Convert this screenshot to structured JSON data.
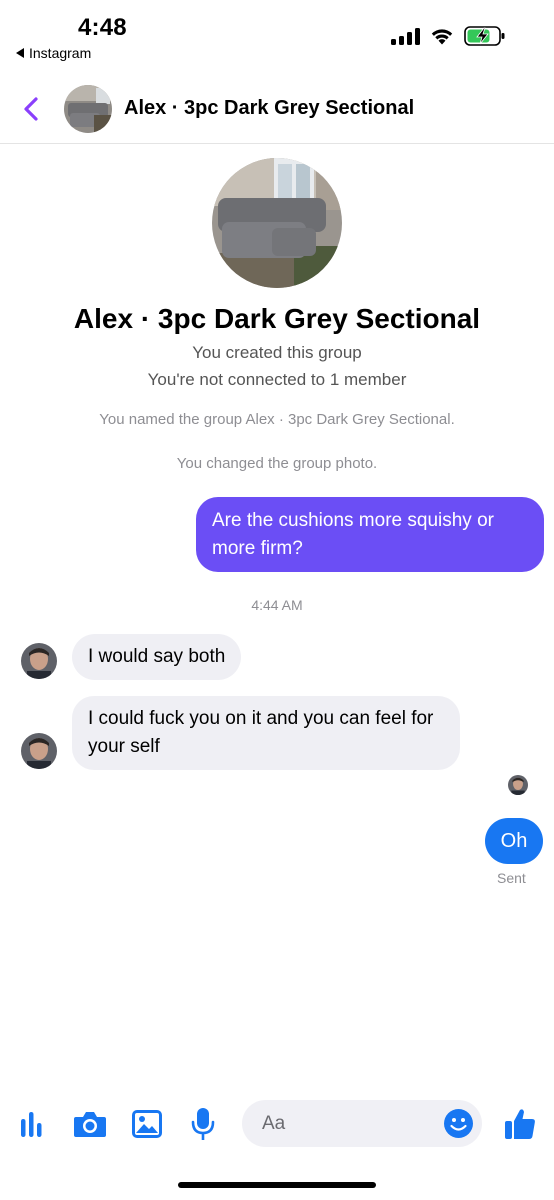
{
  "status_bar": {
    "time": "4:48",
    "back_app_label": "Instagram"
  },
  "header": {
    "title": "Alex · 3pc Dark Grey Sectional"
  },
  "group_info": {
    "name": "Alex · 3pc Dark Grey Sectional",
    "created_text": "You created this group",
    "connection_text": "You're not connected to 1 member"
  },
  "events": [
    "You named the group Alex · 3pc Dark Grey Sectional.",
    "You changed the group photo."
  ],
  "messages": {
    "outgoing_1": "Are the cushions more squishy or more firm?",
    "timestamp": "4:44 AM",
    "incoming_1": "I would say both",
    "incoming_2": "I could fuck you on it and you can feel for your self",
    "outgoing_2": "Oh",
    "sent_status": "Sent"
  },
  "composer": {
    "placeholder": "Aa",
    "icons": [
      "audio-bars-icon",
      "camera-icon",
      "photo-icon",
      "microphone-icon",
      "emoji-icon",
      "thumbs-up-icon"
    ]
  },
  "colors": {
    "accent_purple": "#6b4ef5",
    "messenger_blue": "#1877f2",
    "back_chevron": "#8a3ffc",
    "incoming_bubble": "#efeff4",
    "battery_green": "#34c759"
  }
}
